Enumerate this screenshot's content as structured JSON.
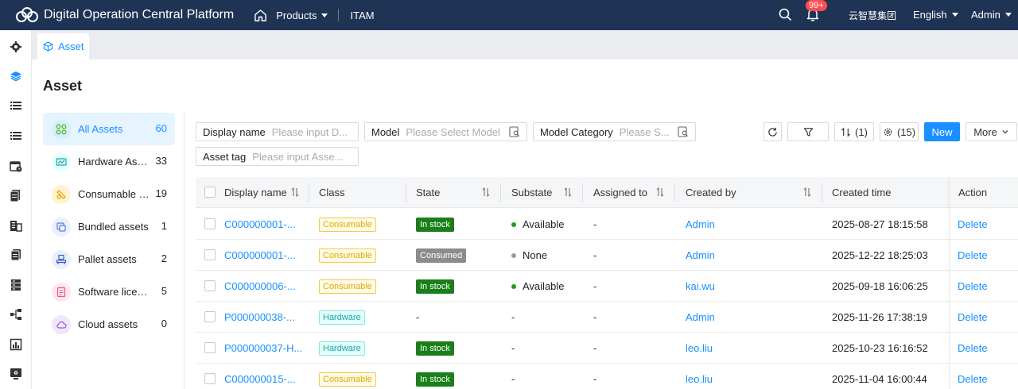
{
  "header": {
    "title": "Digital Operation Central Platform",
    "products_label": "Products",
    "itam_label": "ITAM",
    "notification_badge": "99+",
    "org_name": "云智慧集团",
    "language": "English",
    "user": "Admin"
  },
  "tabs": [
    {
      "label": "Asset"
    }
  ],
  "page_title": "Asset",
  "categories": [
    {
      "label": "All Assets",
      "count": "60",
      "icon": "grid-icon",
      "color": "#52c41a",
      "bg": "#e6f4ff"
    },
    {
      "label": "Hardware Asset",
      "count": "33",
      "icon": "hardware-icon",
      "color": "#13a8a8",
      "bg": "#e6fffb"
    },
    {
      "label": "Consumable assets",
      "count": "19",
      "icon": "consumable-icon",
      "color": "#e6a700",
      "bg": "#fff7e0"
    },
    {
      "label": "Bundled assets",
      "count": "1",
      "icon": "bundle-icon",
      "color": "#5b7bd5",
      "bg": "#eef2fb"
    },
    {
      "label": "Pallet assets",
      "count": "2",
      "icon": "pallet-icon",
      "color": "#3a5ccc",
      "bg": "#eef2fb"
    },
    {
      "label": "Software licenses",
      "count": "5",
      "icon": "license-icon",
      "color": "#e8578f",
      "bg": "#fdeef3"
    },
    {
      "label": "Cloud assets",
      "count": "0",
      "icon": "cloud-icon",
      "color": "#9b59d0",
      "bg": "#f4ecfb"
    }
  ],
  "filters": {
    "display_name": {
      "label": "Display name",
      "placeholder": "Please input D..."
    },
    "model": {
      "label": "Model",
      "placeholder": "Please Select Model"
    },
    "model_category": {
      "label": "Model Category",
      "placeholder": "Please S..."
    },
    "asset_tag": {
      "label": "Asset tag",
      "placeholder": "Please input Asse..."
    }
  },
  "toolbar": {
    "sort_label": "(1)",
    "columns_label": "(15)",
    "new_label": "New",
    "more_label": "More"
  },
  "table": {
    "columns": [
      "Display name",
      "Class",
      "State",
      "Substate",
      "Assigned to",
      "Created by",
      "Created time",
      "Action"
    ],
    "rows": [
      {
        "name": "C000000001-...",
        "class": "Consumable",
        "state": "In stock",
        "substate": "Available",
        "assigned": "-",
        "created_by": "Admin",
        "created_time": "2025-08-27 18:15:58",
        "action": "Delete"
      },
      {
        "name": "C000000001-...",
        "class": "Consumable",
        "state": "Consumed",
        "substate": "None",
        "assigned": "-",
        "created_by": "Admin",
        "created_time": "2025-12-22 18:25:03",
        "action": "Delete"
      },
      {
        "name": "C000000006-...",
        "class": "Consumable",
        "state": "In stock",
        "substate": "Available",
        "assigned": "-",
        "created_by": "kai.wu",
        "created_time": "2025-09-18 16:06:25",
        "action": "Delete"
      },
      {
        "name": "P000000038-...",
        "class": "Hardware",
        "state": "-",
        "substate": "-",
        "assigned": "-",
        "created_by": "Admin",
        "created_time": "2025-11-26 17:38:19",
        "action": "Delete"
      },
      {
        "name": "P000000037-H...",
        "class": "Hardware",
        "state": "In stock",
        "substate": "-",
        "assigned": "-",
        "created_by": "leo.liu",
        "created_time": "2025-10-23 16:16:52",
        "action": "Delete"
      },
      {
        "name": "C000000015-...",
        "class": "Consumable",
        "state": "In stock",
        "substate": "-",
        "assigned": "-",
        "created_by": "leo.liu",
        "created_time": "2025-11-04 16:00:44",
        "action": "Delete"
      }
    ]
  },
  "colors": {
    "header_bg": "#1f3354",
    "accent": "#1890ff",
    "in_stock": "#1a7f1a",
    "consumed": "#8c8c8c",
    "available_dot": "#1a9e1a",
    "none_dot": "#9b9b9b"
  }
}
